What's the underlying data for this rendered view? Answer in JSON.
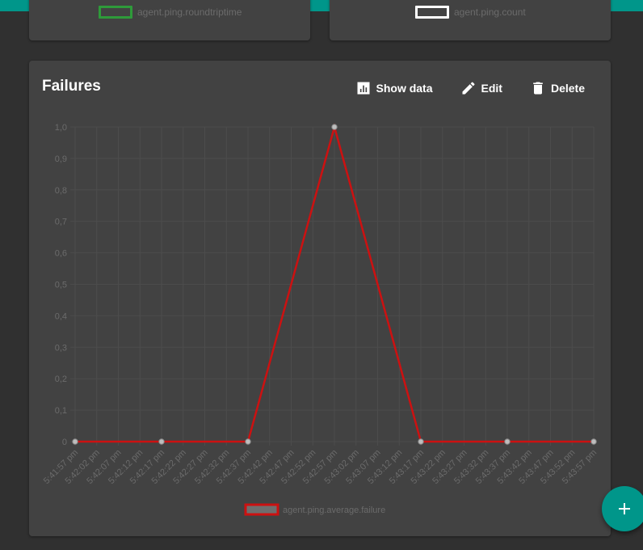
{
  "top_cards": [
    {
      "legend_label": "agent.ping.roundtriptime",
      "legend_color": "#2e9a3a"
    },
    {
      "legend_label": "agent.ping.count",
      "legend_color": "#ffffff"
    }
  ],
  "main_card": {
    "title": "Failures",
    "actions": {
      "show_data": "Show data",
      "edit": "Edit",
      "delete": "Delete"
    }
  },
  "chart_data": {
    "type": "line",
    "title": "",
    "xlabel": "",
    "ylabel": "",
    "ylim": [
      0,
      1
    ],
    "y_ticks": [
      "0",
      "0,1",
      "0,2",
      "0,3",
      "0,4",
      "0,5",
      "0,6",
      "0,7",
      "0,8",
      "0,9",
      "1,0"
    ],
    "categories": [
      "5:41:57 pm",
      "5:42:02 pm",
      "5:42:07 pm",
      "5:42:12 pm",
      "5:42:17 pm",
      "5:42:22 pm",
      "5:42:27 pm",
      "5:42:32 pm",
      "5:42:37 pm",
      "5:42:42 pm",
      "5:42:47 pm",
      "5:42:52 pm",
      "5:42:57 pm",
      "5:43:02 pm",
      "5:43:07 pm",
      "5:43:12 pm",
      "5:43:17 pm",
      "5:43:22 pm",
      "5:43:27 pm",
      "5:43:32 pm",
      "5:43:37 pm",
      "5:43:42 pm",
      "5:43:47 pm",
      "5:43:52 pm",
      "5:43:57 pm"
    ],
    "series": [
      {
        "name": "agent.ping.average.failure",
        "color": "#cc1111",
        "points": [
          {
            "x": "5:41:57 pm",
            "y": 0
          },
          {
            "x": "5:42:17 pm",
            "y": 0
          },
          {
            "x": "5:42:37 pm",
            "y": 0
          },
          {
            "x": "5:42:57 pm",
            "y": 1
          },
          {
            "x": "5:43:17 pm",
            "y": 0
          },
          {
            "x": "5:43:37 pm",
            "y": 0
          },
          {
            "x": "5:43:57 pm",
            "y": 0
          }
        ]
      }
    ],
    "grid": true,
    "legend_position": "bottom"
  },
  "fab": {
    "icon": "plus-icon"
  }
}
